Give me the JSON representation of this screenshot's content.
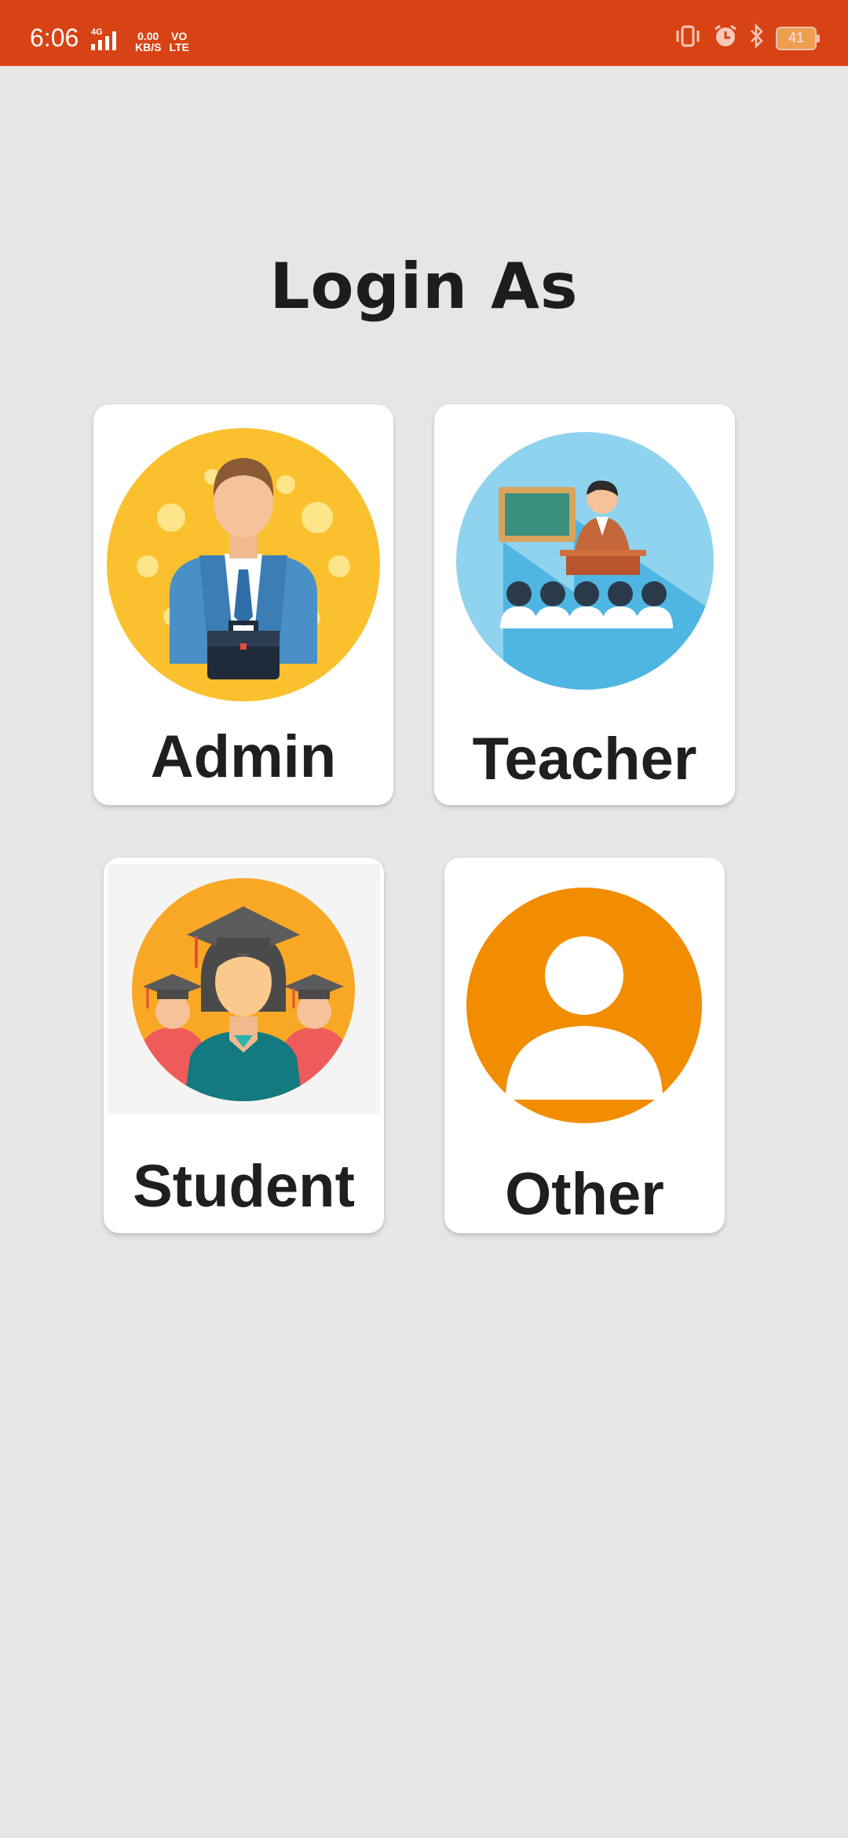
{
  "status_bar": {
    "time": "6:06",
    "network_type": "4G",
    "data_speed_value": "0.00",
    "data_speed_unit": "KB/S",
    "volte_top": "VO",
    "volte_bottom": "LTE",
    "battery_level": "41",
    "icons": [
      "signal-icon",
      "vibrate-icon",
      "alarm-icon",
      "bluetooth-icon",
      "battery-icon"
    ]
  },
  "page": {
    "title": "Login As"
  },
  "roles": {
    "admin": {
      "label": "Admin",
      "icon": "admin-avatar-icon"
    },
    "teacher": {
      "label": "Teacher",
      "icon": "teacher-classroom-icon"
    },
    "student": {
      "label": "Student",
      "icon": "student-graduates-icon"
    },
    "other": {
      "label": "Other",
      "icon": "generic-user-icon"
    }
  },
  "colors": {
    "status_bar": "#d84315",
    "background": "#e6e6e6",
    "card": "#ffffff",
    "admin_circle": "#fbc02d",
    "teacher_circle": "#8fd3ee",
    "student_circle": "#f9a825",
    "other_icon": "#f28c00"
  }
}
